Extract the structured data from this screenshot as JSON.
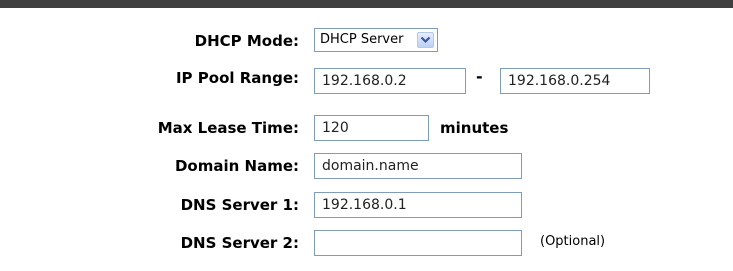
{
  "dhcp_mode": {
    "label": "DHCP Mode:",
    "selected": "DHCP Server",
    "arrow_icon": "chevron-down-icon"
  },
  "ip_pool_range": {
    "label": "IP Pool Range:",
    "start": "192.168.0.2",
    "separator": "-",
    "end": "192.168.0.254"
  },
  "max_lease_time": {
    "label": "Max Lease Time:",
    "value": "120",
    "unit": "minutes"
  },
  "domain_name": {
    "label": "Domain Name:",
    "value": "domain.name"
  },
  "dns_server_1": {
    "label": "DNS Server 1:",
    "value": "192.168.0.1"
  },
  "dns_server_2": {
    "label": "DNS Server 2:",
    "value": "",
    "note": "(Optional)"
  },
  "colors": {
    "header_bar": "#404040",
    "input_border": "#7f9db9",
    "arrow_button": "#bcd0f4"
  }
}
